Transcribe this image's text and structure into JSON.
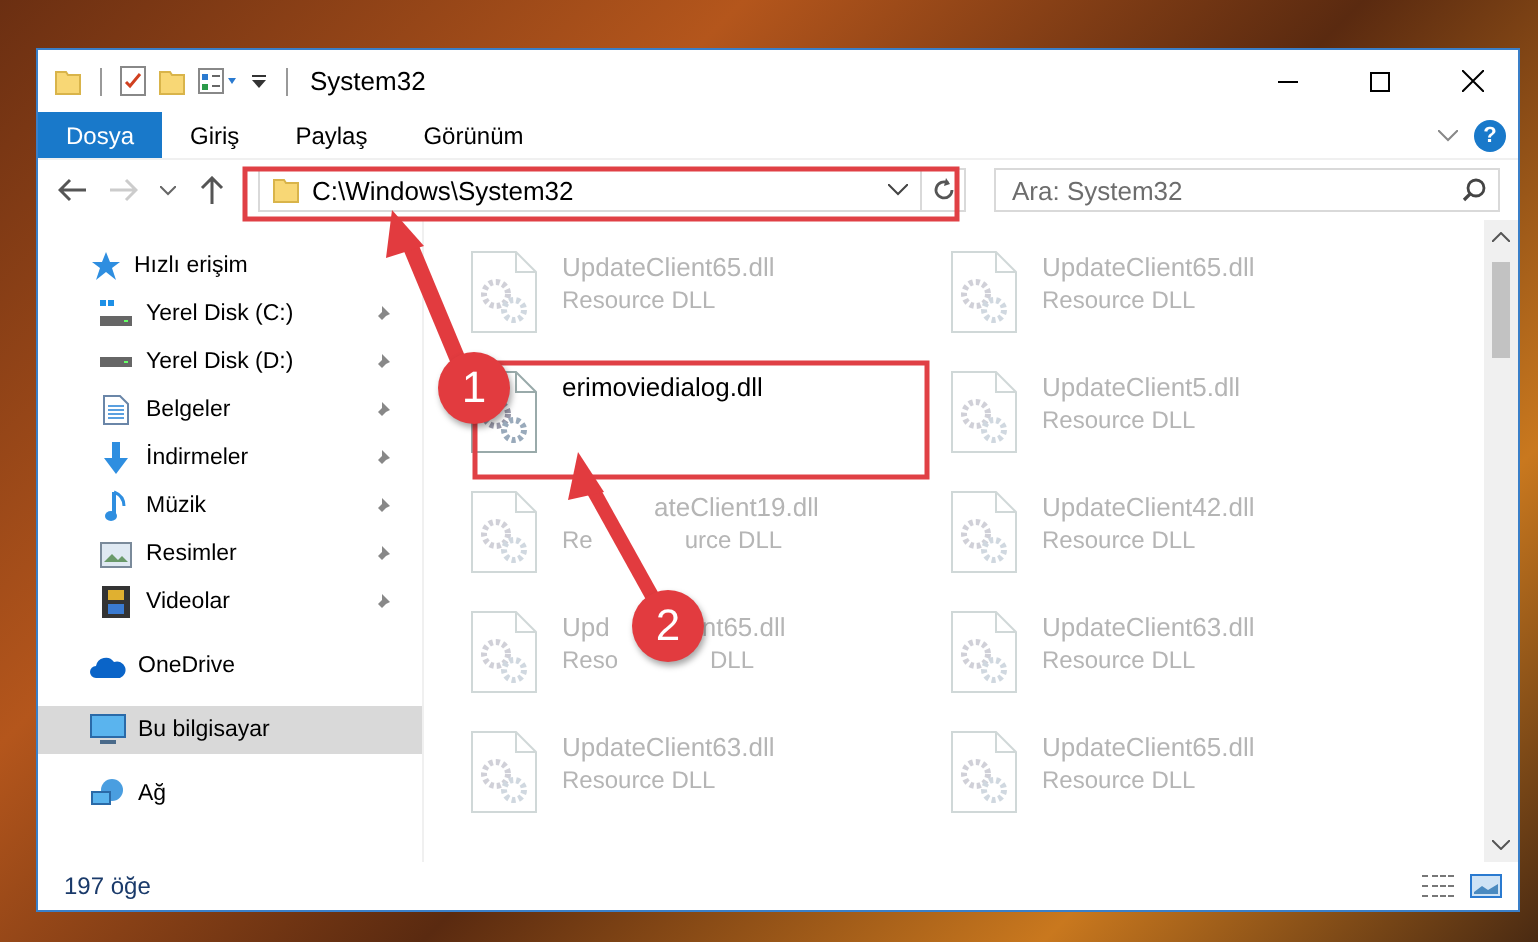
{
  "window": {
    "title": "System32"
  },
  "ribbon": {
    "tabs": [
      {
        "label": "Dosya",
        "selected": true
      },
      {
        "label": "Giriş",
        "selected": false
      },
      {
        "label": "Paylaş",
        "selected": false
      },
      {
        "label": "Görünüm",
        "selected": false
      }
    ],
    "help": "?"
  },
  "address_bar": {
    "path": "C:\\Windows\\System32"
  },
  "search": {
    "placeholder": "Ara: System32"
  },
  "navigation": [
    {
      "label": "Hızlı erişim",
      "selected": false,
      "children": [
        {
          "label": "Yerel Disk (C:)",
          "selected": false,
          "pinned": true
        },
        {
          "label": "Yerel Disk (D:)",
          "selected": false,
          "pinned": true
        },
        {
          "label": "Belgeler",
          "selected": false,
          "pinned": true
        },
        {
          "label": "İndirmeler",
          "selected": false,
          "pinned": true
        },
        {
          "label": "Müzik",
          "selected": false,
          "pinned": true
        },
        {
          "label": "Resimler",
          "selected": false,
          "pinned": true
        },
        {
          "label": "Videolar",
          "selected": false,
          "pinned": true
        }
      ]
    },
    {
      "label": "OneDrive",
      "selected": false
    },
    {
      "label": "Bu bilgisayar",
      "selected": true
    },
    {
      "label": "Ağ",
      "selected": false
    }
  ],
  "files": [
    {
      "name": "UpdateClient65.dll",
      "type": "Resource DLL",
      "kind": "blurred"
    },
    {
      "name": "UpdateClient65.dll",
      "type": "Resource DLL",
      "kind": "blurred"
    },
    {
      "name": "erimoviedialog.dll",
      "kind": "clear"
    },
    {
      "name": "UpdateClient5.dll",
      "type": "Resource DLL",
      "kind": "blurred"
    },
    {
      "name_parts": [
        "ateClient19.dll"
      ],
      "hidden_start": true,
      "type_parts": [
        "Re",
        "urce DLL"
      ],
      "kind": "covered"
    },
    {
      "name": "UpdateClient42.dll",
      "type": "Resource DLL",
      "kind": "blurred"
    },
    {
      "name_parts": [
        "Upd",
        "nt65.dll"
      ],
      "hidden_start": false,
      "type_parts": [
        "Reso",
        "DLL"
      ],
      "kind": "covered"
    },
    {
      "name": "UpdateClient63.dll",
      "type": "Resource DLL",
      "kind": "blurred"
    },
    {
      "name": "UpdateClient63.dll",
      "type": "Resource DLL",
      "kind": "blurred"
    },
    {
      "name": "UpdateClient65.dll",
      "type": "Resource DLL",
      "kind": "blurred"
    }
  ],
  "status_bar": {
    "item_count": "197 öğe"
  },
  "annotations": [
    {
      "number": "1"
    },
    {
      "number": "2"
    }
  ]
}
